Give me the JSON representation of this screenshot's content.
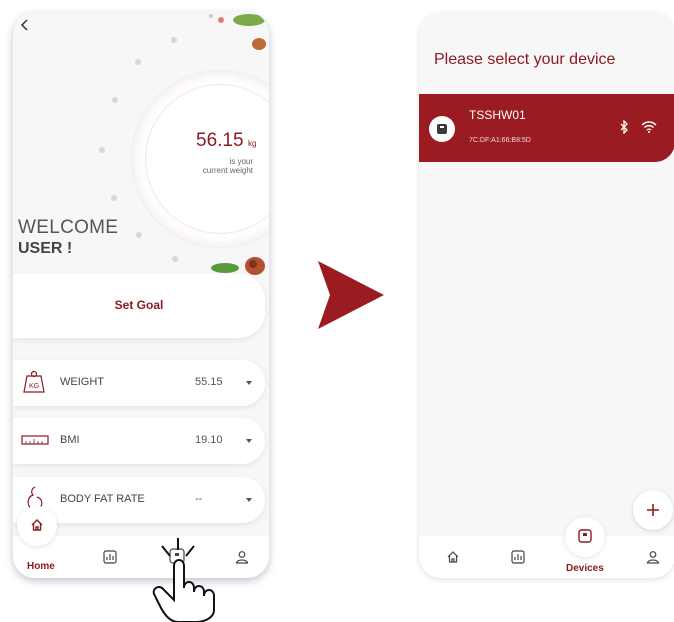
{
  "left_screen": {
    "weight_value": "56.15",
    "weight_unit": "kg",
    "weight_caption_1": "is your",
    "weight_caption_2": "current weight",
    "welcome_line1": "WELCOME",
    "welcome_line2": "USER !",
    "set_goal_label": "Set Goal",
    "metrics": [
      {
        "label": "WEIGHT",
        "value": "55.15"
      },
      {
        "label": "BMI",
        "value": "19.10"
      },
      {
        "label": "BODY FAT RATE",
        "value": "--"
      }
    ],
    "nav_home_label": "Home"
  },
  "right_screen": {
    "title": "Please select your device",
    "device": {
      "name": "TSSHW01",
      "mac": "7C:DF:A1:66:B8:5D"
    },
    "nav_devices_label": "Devices"
  },
  "colors": {
    "accent": "#8b1c22",
    "arrow": "#9b1c20"
  }
}
